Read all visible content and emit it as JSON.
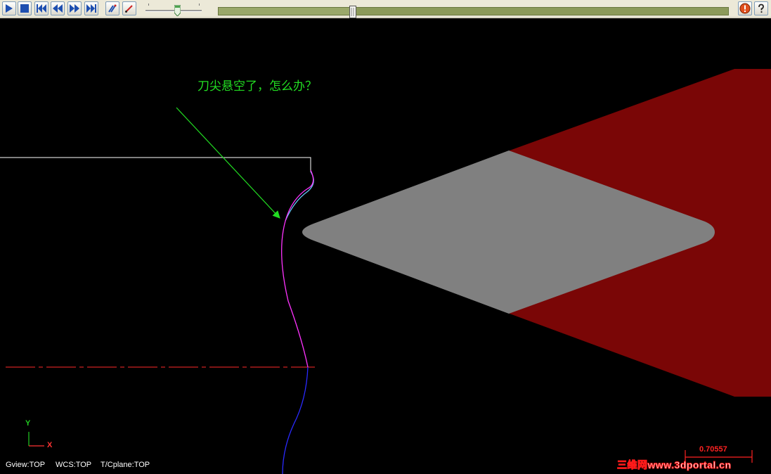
{
  "toolbar": {
    "buttons": [
      "play",
      "stop",
      "first-step",
      "step-back",
      "step-forward",
      "last-step",
      "path-display",
      "tool-display"
    ],
    "speed_level": 0.6,
    "progress_fraction": 0.26,
    "right_buttons": [
      "stop-warning",
      "help"
    ]
  },
  "viewport": {
    "annotation": "刀尖悬空了，怎么办？",
    "status": {
      "gview": "Gview:TOP",
      "wcs": "WCS:TOP",
      "tcplane": "T/Cplane:TOP"
    },
    "axis": {
      "y": "Y",
      "x": "X"
    },
    "scale_value": "0.70557",
    "watermark": "三维网www.3dportal.cn"
  },
  "colors": {
    "background": "#000000",
    "insert": "#808080",
    "holder": "#7a0606",
    "part_outline": "#ffffff",
    "toolpath_magenta": "#ff33ff",
    "toolpath_blue": "#2a2aff",
    "toolpath_cyan": "#66ccff",
    "centerline": "#cc2222",
    "arrow": "#22dd22",
    "annotation": "#22dd22"
  }
}
